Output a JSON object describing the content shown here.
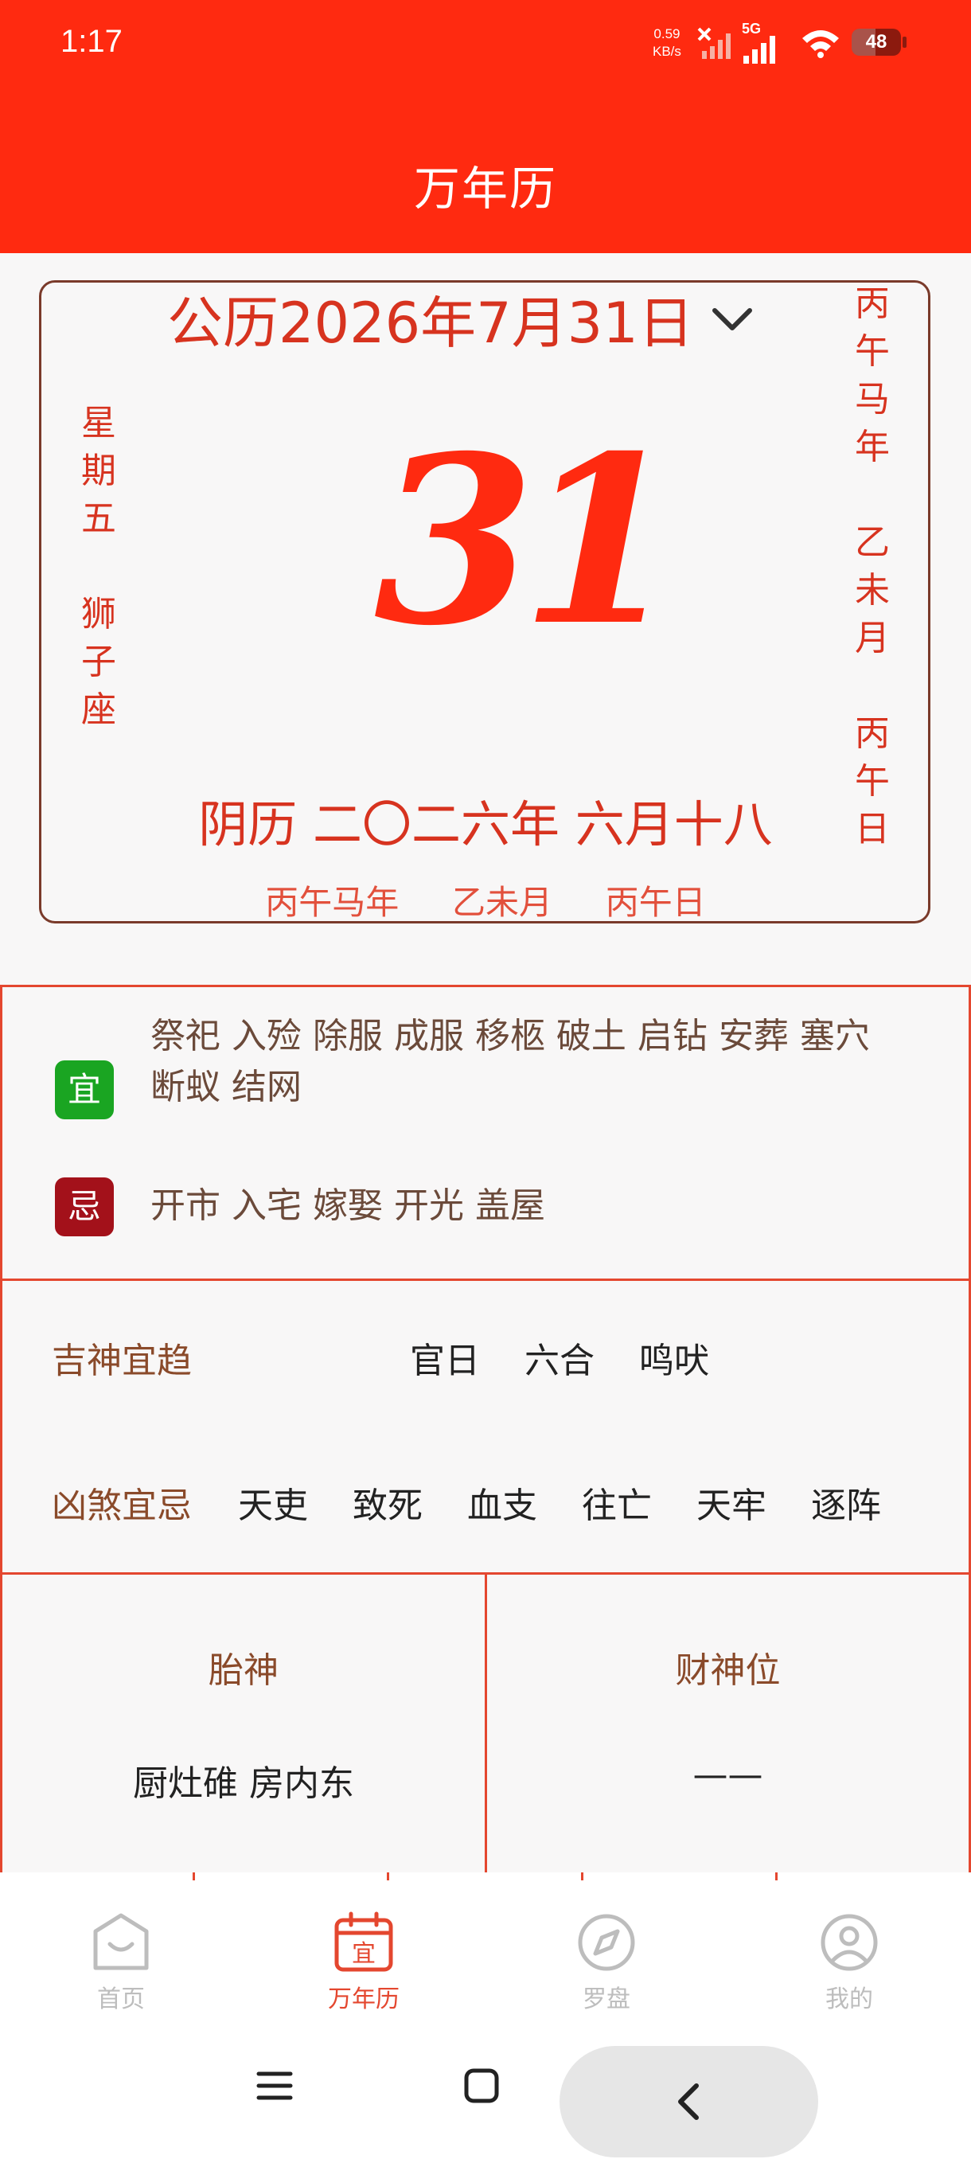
{
  "status": {
    "time": "1:17",
    "net_speed_value": "0.59",
    "net_speed_unit": "KB/s",
    "network": "5G",
    "battery": "48"
  },
  "header": {
    "title": "万年历"
  },
  "date_card": {
    "solar_date": "公历2026年7月31日",
    "weekday_chars": [
      "星",
      "期",
      "五"
    ],
    "zodiac_chars": [
      "狮",
      "子",
      "座"
    ],
    "year_chars": [
      "丙",
      "午",
      "马",
      "年"
    ],
    "month_chars": [
      "乙",
      "未",
      "月"
    ],
    "day_chars": [
      "丙",
      "午",
      "日"
    ],
    "big_day": "31",
    "lunar_date": "阴历 二〇二六年 六月十八",
    "ganzhi": "丙午马年  乙未月  丙午日"
  },
  "yiji": {
    "yi_label": "宜",
    "yi_text": "祭祀 入殓 除服 成服 移柩 破土 启钻 安葬 塞穴 断蚁 结网",
    "ji_label": "忌",
    "ji_text": "开市 入宅 嫁娶 开光 盖屋"
  },
  "shensha": {
    "ji_label": "吉神宜趋",
    "ji_items": [
      "官日",
      "六合",
      "鸣吠"
    ],
    "xiong_label": "凶煞宜忌",
    "xiong_items": [
      "天吏",
      "致死",
      "血支",
      "往亡",
      "天牢",
      "逐阵"
    ]
  },
  "positions": {
    "taishen_label": "胎神",
    "taishen_value": "厨灶碓 房内东",
    "caishen_label": "财神位",
    "caishen_value": "——"
  },
  "nav": {
    "items": [
      {
        "label": "首页",
        "icon": "home-icon"
      },
      {
        "label": "万年历",
        "icon": "calendar-icon"
      },
      {
        "label": "罗盘",
        "icon": "compass-icon"
      },
      {
        "label": "我的",
        "icon": "profile-icon"
      }
    ],
    "active_index": 1
  },
  "colors": {
    "accent": "#ff2a10",
    "text_red": "#d7331f",
    "yi_green": "#1aa522",
    "ji_red": "#a3111a"
  }
}
